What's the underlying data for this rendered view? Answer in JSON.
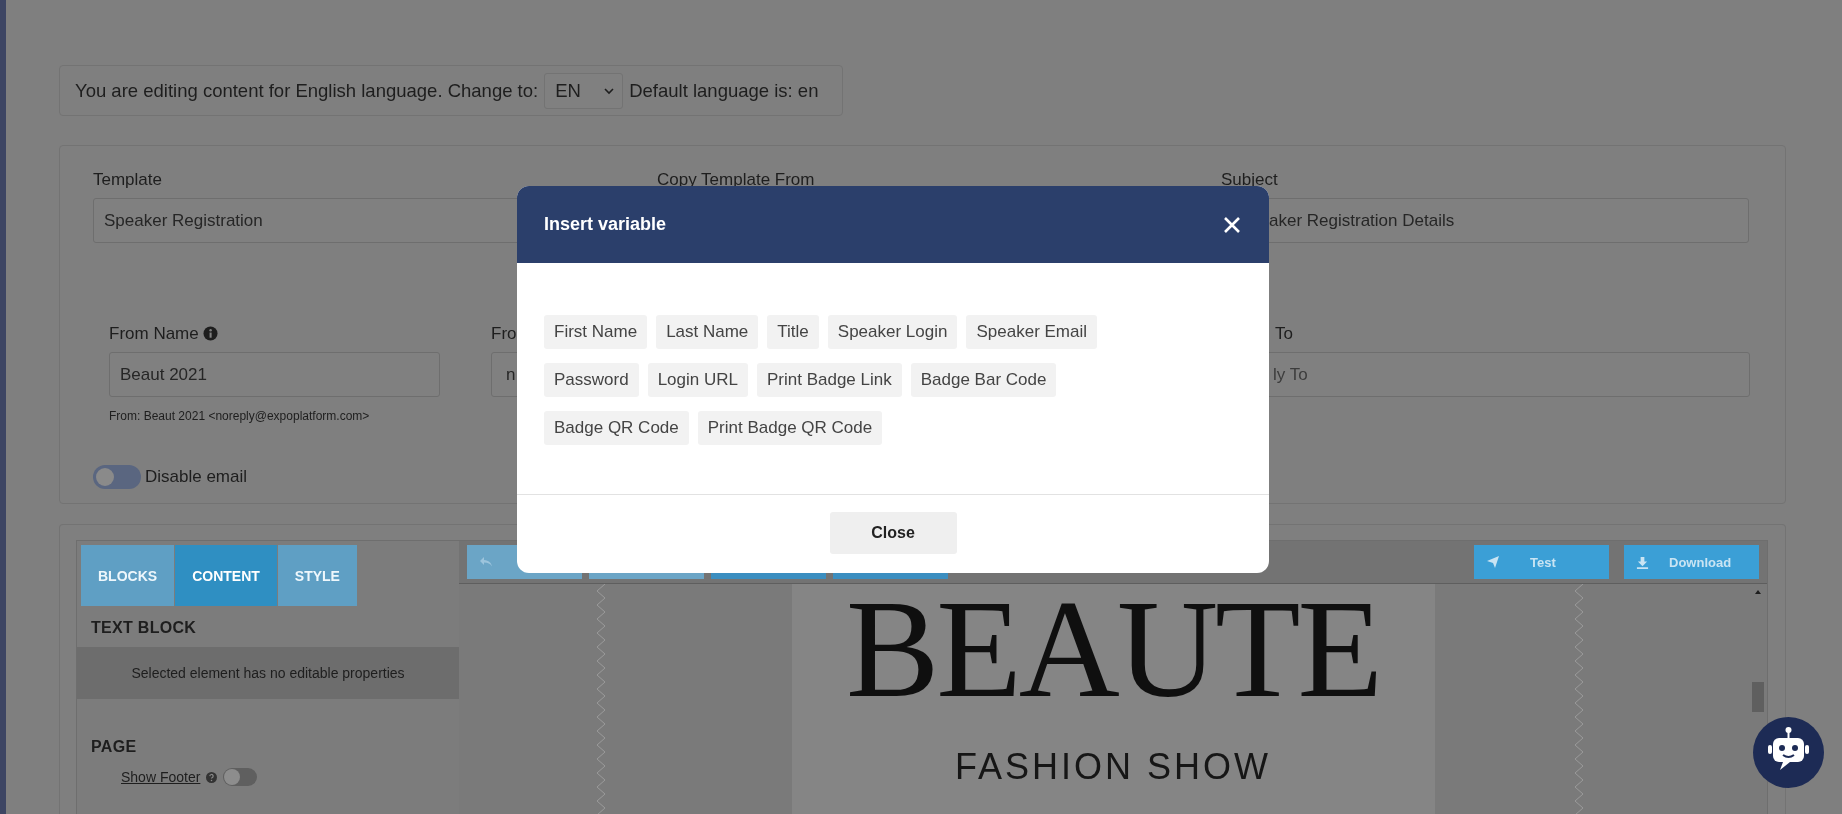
{
  "language_bar": {
    "text": "You are editing content for English language. Change to:",
    "select": "EN",
    "default_text": "Default language is: en"
  },
  "form": {
    "template": {
      "label": "Template",
      "value": "Speaker Registration"
    },
    "copy_template": {
      "label": "Copy Template From"
    },
    "subject": {
      "label": "Subject",
      "value": "aker Registration Details"
    },
    "from_name": {
      "label": "From Name",
      "value": "Beaut 2021",
      "hint": "From: Beaut 2021 <noreply@expoplatform.com>"
    },
    "from_email": {
      "label": "Fro",
      "value": "n"
    },
    "reply_to": {
      "label": "To",
      "placeholder": "ly To"
    },
    "disable_email": {
      "label": "Disable email",
      "on": false
    }
  },
  "editor": {
    "tabs": [
      {
        "label": "BLOCKS",
        "selected": false
      },
      {
        "label": "CONTENT",
        "selected": true
      },
      {
        "label": "STYLE",
        "selected": false
      }
    ],
    "section_title": "TEXT BLOCK",
    "notice": "Selected element has no editable properties",
    "page_title": "PAGE",
    "show_footer": {
      "label": "Show Footer",
      "on": false
    },
    "toolbar_buttons": [
      {
        "label": "Test",
        "kind": "send"
      },
      {
        "label": "Download",
        "kind": "download"
      }
    ],
    "email_preview": {
      "logo": "BEAUTE",
      "subtitle": "FASHION SHOW"
    }
  },
  "modal": {
    "title": "Insert variable",
    "variables": [
      "First Name",
      "Last Name",
      "Title",
      "Speaker Login",
      "Speaker Email",
      "Password",
      "Login URL",
      "Print Badge Link",
      "Badge Bar Code",
      "Badge QR Code",
      "Print Badge QR Code"
    ],
    "close_button": "Close"
  }
}
